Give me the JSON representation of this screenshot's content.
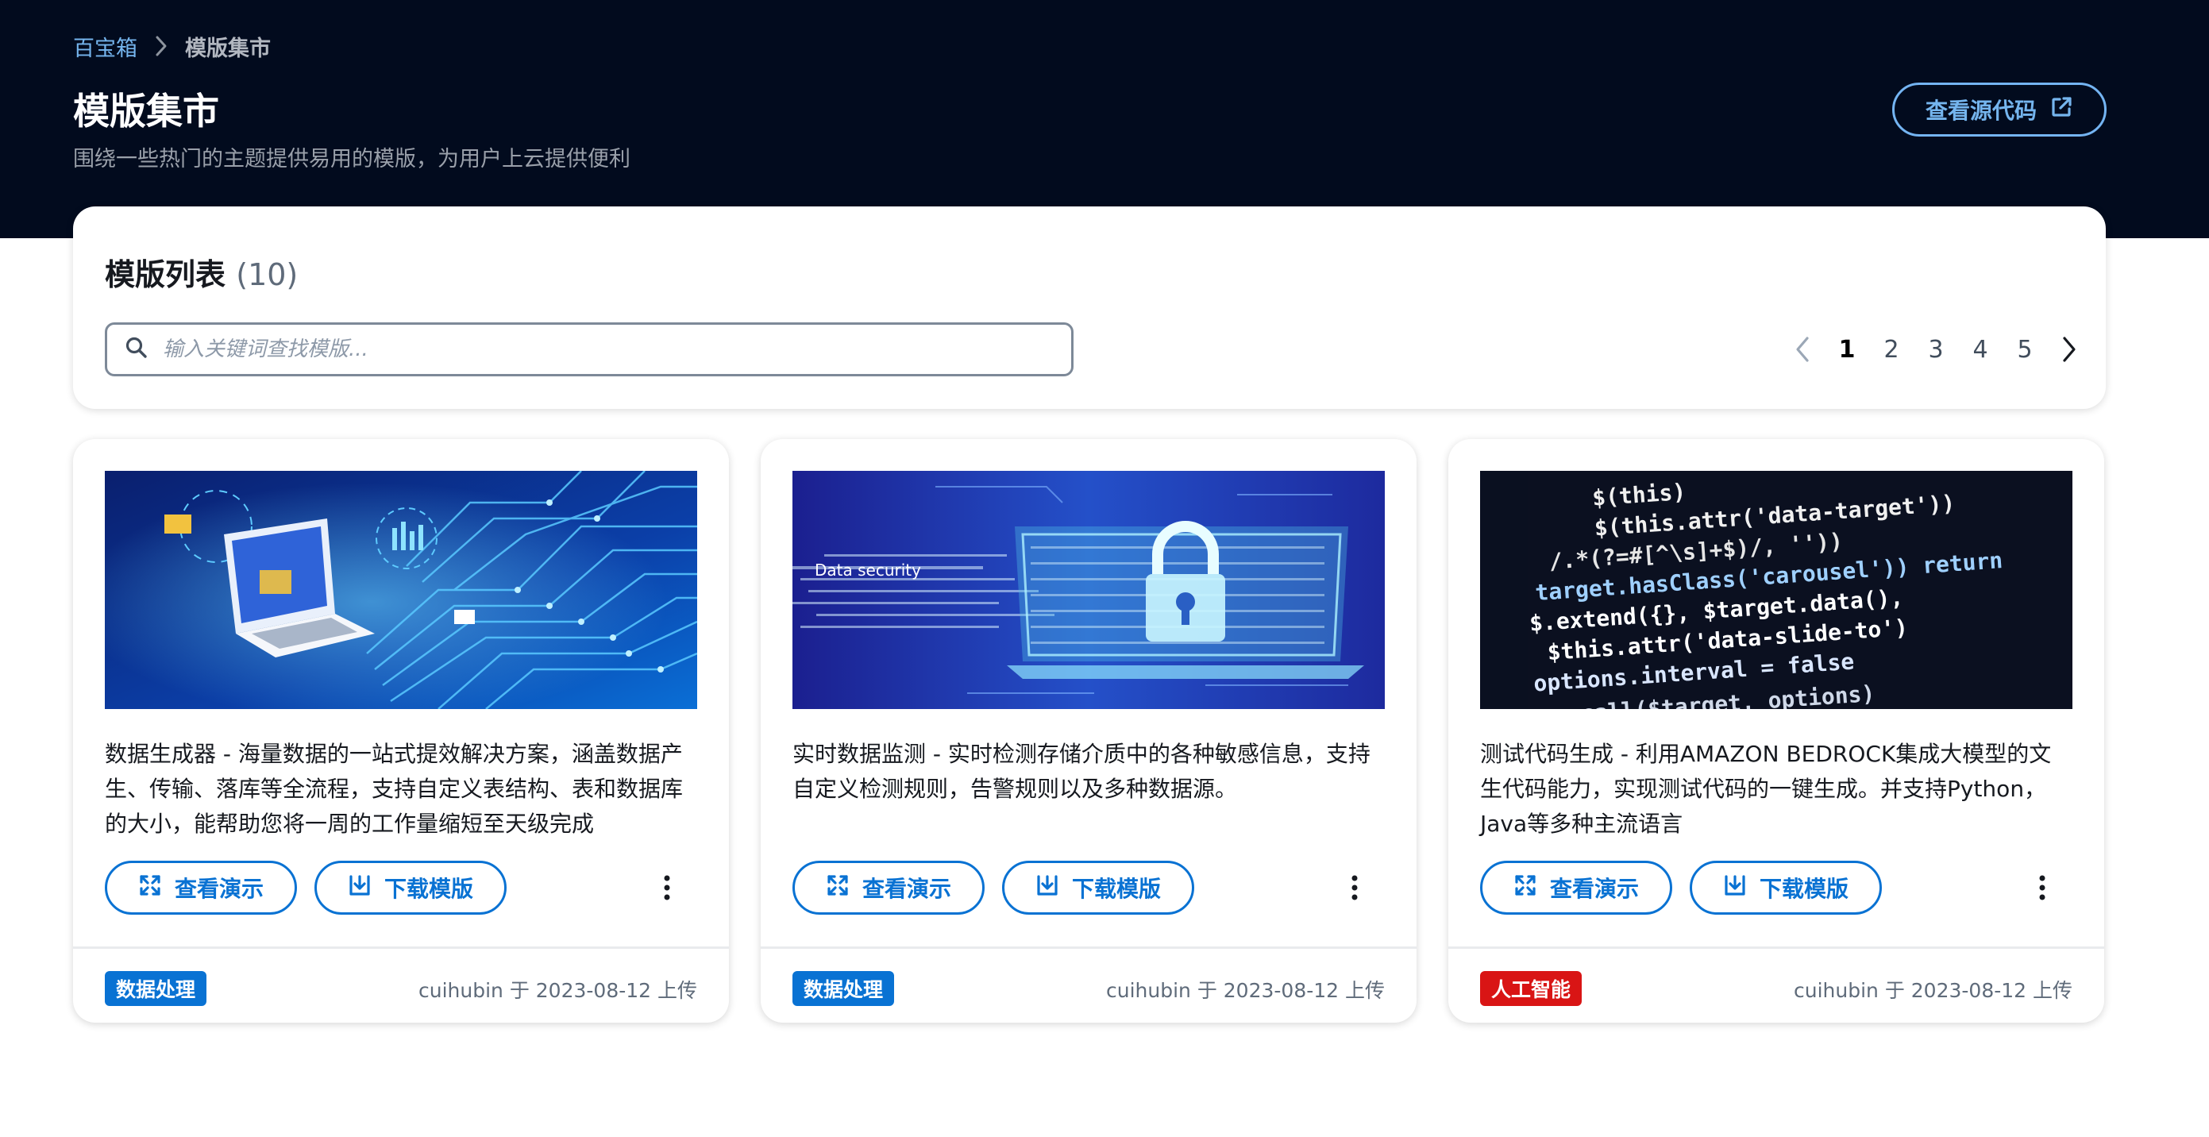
{
  "breadcrumb": {
    "root": "百宝箱",
    "current": "模版集市"
  },
  "header": {
    "title": "模版集市",
    "subtitle": "围绕一些热门的主题提供易用的模版，为用户上云提供便利",
    "source_button": "查看源代码"
  },
  "list": {
    "title": "模版列表",
    "count": "(10)",
    "search_placeholder": "输入关键词查找模版...",
    "pages": [
      "1",
      "2",
      "3",
      "4",
      "5"
    ],
    "current_page": "1"
  },
  "cards": [
    {
      "description": "数据生成器 - 海量数据的一站式提效解决方案，涵盖数据产生、传输、落库等全流程，支持自定义表结构、表和数据库的大小，能帮助您将一周的工作量缩短至天级完成",
      "demo_label": "查看演示",
      "download_label": "下载模版",
      "tag": "数据处理",
      "uploader": "cuihubin 于 2023-08-12 上传"
    },
    {
      "description": "实时数据监测 - 实时检测存储介质中的各种敏感信息，支持自定义检测规则，告警规则以及多种数据源。",
      "image_caption": "Data security",
      "demo_label": "查看演示",
      "download_label": "下载模版",
      "tag": "数据处理",
      "uploader": "cuihubin 于 2023-08-12 上传"
    },
    {
      "description": "测试代码生成 - 利用AMAZON BEDROCK集成大模型的文生代码能力，实现测试代码的一键生成。并支持Python，Java等多种主流语言",
      "image_code": [
        "$(this)",
        "$(this.attr('data-target'))",
        "/.*(?=#[^\\s]+$)/, ''))",
        "target.hasClass('carousel')) return",
        "$.extend({}, $target.data(),",
        "$this.attr('data-slide-to')",
        "options.interval = false",
        ".call($target, options)"
      ],
      "demo_label": "查看演示",
      "download_label": "下载模版",
      "tag": "人工智能",
      "uploader": "cuihubin 于 2023-08-12 上传"
    }
  ],
  "colors": {
    "hero_bg": "#020b1e",
    "accent": "#0972d3",
    "tag_blue": "#0972d3",
    "tag_red": "#d91515"
  },
  "icons": {
    "breadcrumb_separator": "chevron-right-icon",
    "source_button": "external-link-icon",
    "search": "search-icon",
    "demo": "expand-icon",
    "download": "download-icon",
    "more": "vertical-dots-icon",
    "prev_page": "chevron-left-icon",
    "next_page": "chevron-right-icon"
  }
}
